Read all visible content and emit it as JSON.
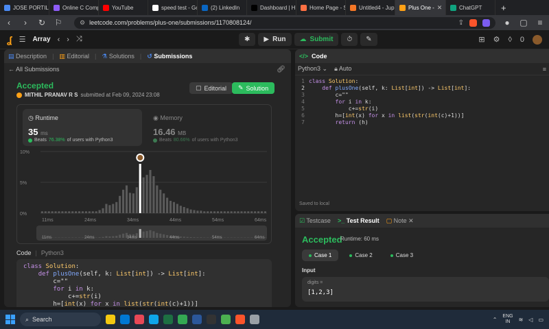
{
  "browser": {
    "tabs": [
      {
        "title": "JOSE PORTILLA",
        "color": "#4a8af4",
        "active": false
      },
      {
        "title": "Online C Comp",
        "color": "#8e5cf7",
        "active": false
      },
      {
        "title": "YouTube",
        "color": "#ff0000",
        "active": false
      },
      {
        "title": "speed test - Go",
        "color": "#ffffff",
        "active": false
      },
      {
        "title": "(2) LinkedIn",
        "color": "#0a66c2",
        "active": false
      },
      {
        "title": "Dashboard | Hu",
        "color": "#000000",
        "active": false
      },
      {
        "title": "Home Page - S",
        "color": "#ff7043",
        "active": false
      },
      {
        "title": "Untitled4 - Jup",
        "color": "#f37626",
        "active": false
      },
      {
        "title": "Plus One -",
        "color": "#ffa116",
        "active": true
      },
      {
        "title": "ChatGPT",
        "color": "#10a37f",
        "active": false
      }
    ],
    "new_tab": "+",
    "url": "leetcode.com/problems/plus-one/submissions/1170808124/"
  },
  "header": {
    "problem_title": "Array",
    "run_label": "Run",
    "submit_label": "Submit",
    "coins": "0"
  },
  "left": {
    "tabs": [
      "Description",
      "Editorial",
      "Solutions",
      "Submissions"
    ],
    "all_submissions": "All Submissions",
    "status": "Accepted",
    "author": "MITHIL PRANAV R S",
    "submitted_text": "submitted at Feb 09, 2024 23:08",
    "editorial_btn": "Editorial",
    "solution_btn": "Solution",
    "runtime": {
      "label": "Runtime",
      "value": "35",
      "unit": "ms",
      "beats_prefix": "Beats",
      "beats_pct": "76.38%",
      "beats_suffix": "of users with Python3"
    },
    "memory": {
      "label": "Memory",
      "value": "16.46",
      "unit": "MB",
      "beats_prefix": "Beats",
      "beats_pct": "80.66%",
      "beats_suffix": "of users with Python3"
    },
    "code_label": "Code",
    "code_lang": "Python3",
    "code_lines": [
      "class Solution:",
      "    def plusOne(self, k: List[int]) -> List[int]:",
      "        c=\"\"",
      "        for i in k:",
      "            c+=str(i)",
      "        h=[int(x) for x in list(str(int(c)+1))]"
    ]
  },
  "right": {
    "panel_title": "Code",
    "lang": "Python3",
    "auto": "Auto",
    "editor_lines": [
      {
        "n": "1",
        "t": "class Solution:"
      },
      {
        "n": "2",
        "t": "    def plusOne(self, k: List[int]) -> List[int]:"
      },
      {
        "n": "3",
        "t": "        c=\"\""
      },
      {
        "n": "4",
        "t": "        for i in k:"
      },
      {
        "n": "5",
        "t": "            c+=str(i)"
      },
      {
        "n": "6",
        "t": "        h=[int(x) for x in list(str(int(c)+1))]"
      },
      {
        "n": "7",
        "t": "        return (h)"
      }
    ],
    "saved": "Saved to local"
  },
  "bottom": {
    "tabs": [
      "Testcase",
      "Test Result",
      "Note"
    ],
    "status": "Accepted",
    "runtime": "Runtime: 60 ms",
    "cases": [
      "Case 1",
      "Case 2",
      "Case 3"
    ],
    "input_label": "Input",
    "var_name": "digits =",
    "var_value": "[1,2,3]"
  },
  "taskbar": {
    "search": "Search",
    "lang_top": "ENG",
    "lang_bottom": "IN"
  },
  "chart_data": {
    "type": "bar",
    "x_ticks": [
      "11ms",
      "24ms",
      "34ms",
      "44ms",
      "54ms",
      "64ms"
    ],
    "y_ticks": [
      "10%",
      "5%",
      "0%"
    ],
    "ylim": [
      0,
      10
    ],
    "highlight_index": 29,
    "values": [
      0.3,
      0.3,
      0.3,
      0.3,
      0.3,
      0.3,
      0.3,
      0.3,
      0.3,
      0.3,
      0.3,
      0.3,
      0.3,
      0.3,
      0.3,
      0.3,
      0.3,
      0.5,
      0.8,
      1.5,
      1.3,
      1.5,
      1.8,
      2.8,
      3.8,
      4.5,
      3.3,
      3.2,
      4.2,
      8.0,
      5.8,
      6.2,
      7.0,
      6.0,
      4.5,
      3.8,
      3.2,
      2.5,
      2.0,
      1.8,
      1.5,
      1.2,
      1.0,
      0.8,
      0.6,
      0.5,
      0.4,
      0.4,
      0.3,
      0.3,
      0.3,
      0.3,
      0.3,
      0.3,
      0.3,
      0.3,
      0.3,
      0.3,
      0.3,
      0.3,
      0.3,
      0.3,
      0.3,
      0.3,
      0.3,
      0.3,
      0.3
    ]
  }
}
